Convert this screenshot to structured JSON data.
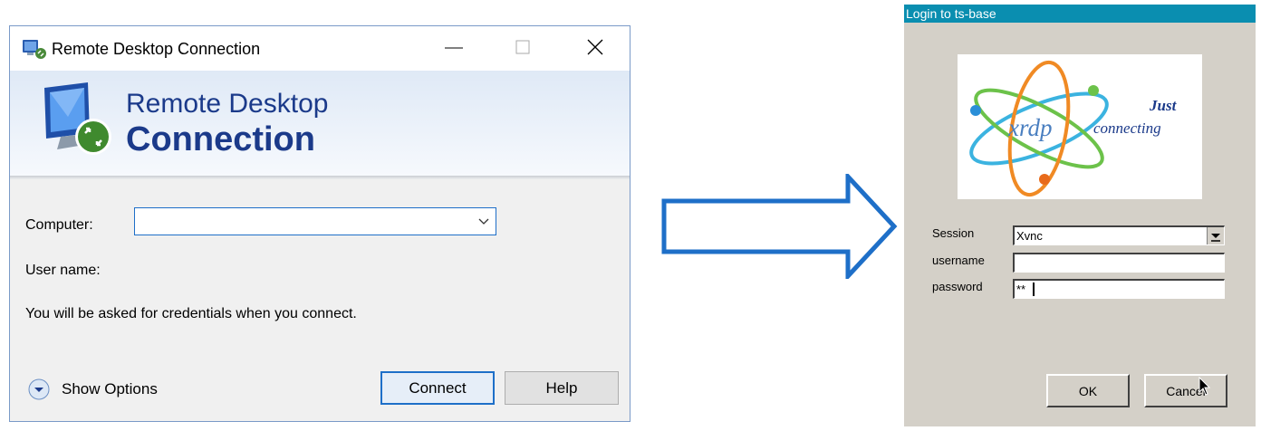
{
  "rdp": {
    "window_title": "Remote Desktop Connection",
    "banner": {
      "line1": "Remote Desktop",
      "line2": "Connection"
    },
    "computer_label": "Computer:",
    "computer_value": "",
    "username_label": "User name:",
    "info_text": "You will be asked for credentials when you connect.",
    "show_options": "Show Options",
    "connect_label": "Connect",
    "help_label": "Help",
    "accent": "#1e6fc8",
    "title_color": "#1b3a8a"
  },
  "arrow": {
    "direction": "right",
    "color": "#1e6fc8"
  },
  "xrdp": {
    "window_title": "Login to ts-base",
    "title_color": "#0a8eb0",
    "logo": {
      "word": "xrdp",
      "tagline1": "Just",
      "tagline2": "connecting"
    },
    "session_label": "Session",
    "session_value": "Xvnc",
    "username_label": "username",
    "username_value": "",
    "password_label": "password",
    "password_value": "**",
    "ok_label": "OK",
    "cancel_label": "Cancel"
  }
}
